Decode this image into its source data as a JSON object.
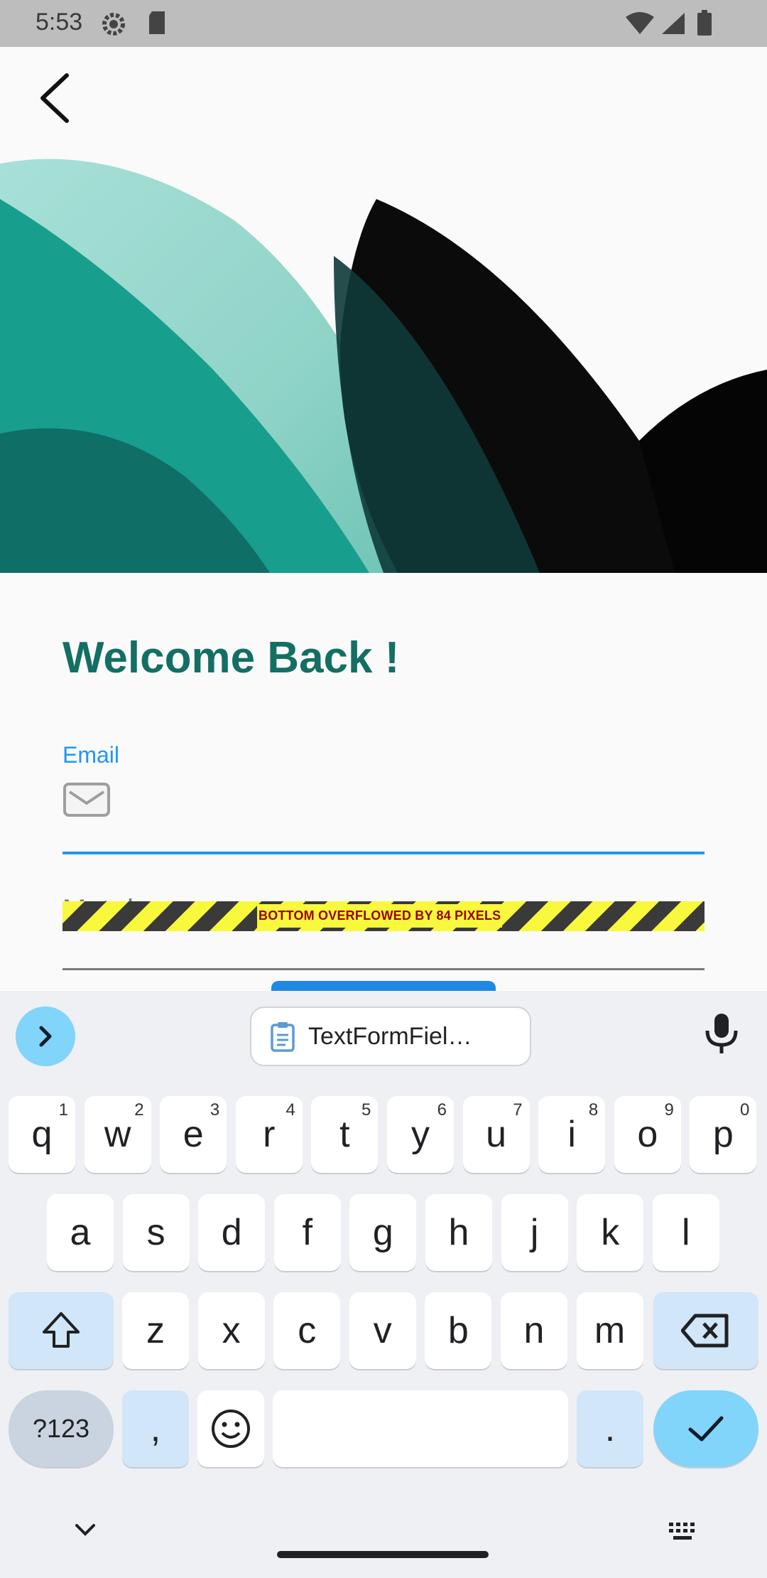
{
  "status_bar": {
    "time": "5:53"
  },
  "screen": {
    "title": "Welcome Back !",
    "email": {
      "label": "Email",
      "value": ""
    },
    "password": {
      "placeholder": "Mot de passe"
    },
    "overflow_warning": "BOTTOM OVERFLOWED BY 84 PIXELS"
  },
  "keyboard": {
    "suggestion_chip": "TextFormFiel…",
    "row1": [
      {
        "k": "q",
        "h": "1"
      },
      {
        "k": "w",
        "h": "2"
      },
      {
        "k": "e",
        "h": "3"
      },
      {
        "k": "r",
        "h": "4"
      },
      {
        "k": "t",
        "h": "5"
      },
      {
        "k": "y",
        "h": "6"
      },
      {
        "k": "u",
        "h": "7"
      },
      {
        "k": "i",
        "h": "8"
      },
      {
        "k": "o",
        "h": "9"
      },
      {
        "k": "p",
        "h": "0"
      }
    ],
    "row2": [
      "a",
      "s",
      "d",
      "f",
      "g",
      "h",
      "j",
      "k",
      "l"
    ],
    "row3": [
      "z",
      "x",
      "c",
      "v",
      "b",
      "n",
      "m"
    ],
    "symbols_label": "?123",
    "comma": ",",
    "period": "."
  },
  "colors": {
    "title": "#136f64",
    "accent": "#2196f3",
    "enter": "#81d4fa"
  }
}
